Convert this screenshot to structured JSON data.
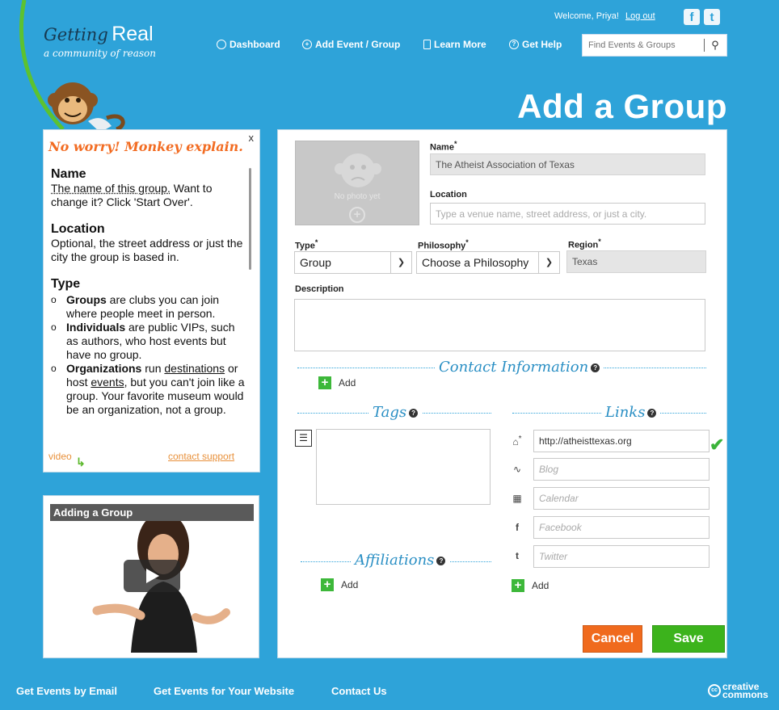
{
  "logo": {
    "word1": "Getting",
    "word2": "Real",
    "tagline": "a community of reason"
  },
  "header": {
    "welcome": "Welcome, Priya!",
    "logout": "Log out",
    "social": {
      "facebook": "f",
      "twitter": "t"
    },
    "nav": {
      "dashboard": "Dashboard",
      "add_event": "Add Event / Group",
      "learn_more": "Learn More",
      "get_help": "Get Help"
    },
    "search_placeholder": "Find Events & Groups",
    "page_title": "Add a Group"
  },
  "help": {
    "close": "x",
    "headline": "No worry! Monkey explain.",
    "name_title": "Name",
    "name_text_a": "The name of this group.",
    "name_text_b": " Want to change it? Click 'Start Over'.",
    "location_title": "Location",
    "location_text": "Optional, the street address or just the city the group is based in.",
    "type_title": "Type",
    "type_items": [
      {
        "bold": "Groups",
        "text": " are clubs you can join where people meet in person."
      },
      {
        "bold": "Individuals",
        "text": " are public VIPs, such as authors, who host events but have no group."
      },
      {
        "bold": "Organizations",
        "text_a": " run ",
        "link1": "destinations",
        "text_b": " or host ",
        "link2": "events",
        "text_c": ", but you can't join like a group. Your favorite museum would be an organization, not a group."
      }
    ],
    "video_link": "video",
    "support_link": "contact support"
  },
  "video": {
    "title": "Adding a Group"
  },
  "form": {
    "photo_placeholder": "No photo yet",
    "name_label": "Name",
    "name_value": "The Atheist Association of Texas",
    "location_label": "Location",
    "location_placeholder": "Type a venue name, street address, or just a city.",
    "type_label": "Type",
    "type_value": "Group",
    "philosophy_label": "Philosophy",
    "philosophy_value": "Choose a Philosophy",
    "region_label": "Region",
    "region_value": "Texas",
    "description_label": "Description",
    "contact_title": "Contact Information",
    "add_label": "Add",
    "tags_title": "Tags",
    "links_title": "Links",
    "affiliations_title": "Affiliations",
    "links": {
      "website_value": "http://atheisttexas.org",
      "blog_placeholder": "Blog",
      "calendar_placeholder": "Calendar",
      "facebook_placeholder": "Facebook",
      "twitter_placeholder": "Twitter"
    },
    "cancel": "Cancel",
    "save": "Save"
  },
  "footer": {
    "email": "Get Events by Email",
    "website": "Get Events for Your Website",
    "contact": "Contact Us",
    "cc_line1": "creative",
    "cc_line2": "commons",
    "cc_mark": "cc"
  },
  "colors": {
    "background": "#2ea3d9",
    "accent_orange": "#f06a1d",
    "accent_green": "#3cb31c",
    "section_title": "#2a8fc4"
  }
}
